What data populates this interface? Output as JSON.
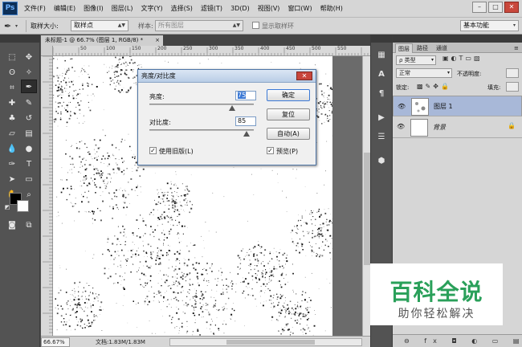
{
  "app": {
    "logo": "Ps"
  },
  "menubar": {
    "items": [
      "文件(F)",
      "编辑(E)",
      "图像(I)",
      "图层(L)",
      "文字(Y)",
      "选择(S)",
      "滤镜(T)",
      "3D(D)",
      "视图(V)",
      "窗口(W)",
      "帮助(H)"
    ],
    "window_buttons": [
      "–",
      "□",
      "✕"
    ]
  },
  "options_bar": {
    "tool_icon": "eyedropper-icon",
    "sample_size_label": "取样大小:",
    "sample_size_value": "取样点",
    "sample_label": "样本:",
    "sample_value": "所有图层",
    "show_ring_label": "显示取样环",
    "workspace_value": "基本功能"
  },
  "document": {
    "tab_title": "未标题-1 @ 66.7% (图层 1, RGB/8) *",
    "tab_close": "×",
    "zoom": "66.67%",
    "doc_size": "文档:1.83M/1.83M"
  },
  "ruler": {
    "ticks": [
      "50",
      "100",
      "150",
      "200",
      "250",
      "300",
      "350",
      "400",
      "450",
      "500",
      "550"
    ]
  },
  "dialog": {
    "title": "亮度/对比度",
    "close": "✕",
    "brightness_label": "亮度:",
    "brightness_value": "75",
    "contrast_label": "对比度:",
    "contrast_value": "85",
    "ok": "确定",
    "reset": "复位",
    "auto": "自动(A)",
    "use_legacy_label": "使用旧版(L)",
    "use_legacy_checked": true,
    "preview_label": "预览(P)",
    "preview_checked": true,
    "brightness_fraction": 0.79,
    "contrast_fraction": 0.93
  },
  "layers_panel": {
    "tabs": [
      "图层",
      "路径",
      "通道"
    ],
    "filter_value": "ρ 类型",
    "blend_mode": "正常",
    "opacity_label": "不透明度:",
    "lock_label": "锁定:",
    "fill_label": "填充:",
    "layers": [
      {
        "name": "图层 1",
        "selected": true,
        "italic": false,
        "locked": false
      },
      {
        "name": "背景",
        "selected": false,
        "italic": true,
        "locked": true
      }
    ],
    "bottom_icons": "⊖ fx ◘ ◐ ▭ ▤ 🗑"
  },
  "colors": {
    "accent_blue": "#3b79d6",
    "watermark_green": "#2aa05a",
    "selected_layer": "#a8b8d8"
  },
  "watermark": {
    "main": "百科全说",
    "sub": "助你轻松解决"
  }
}
